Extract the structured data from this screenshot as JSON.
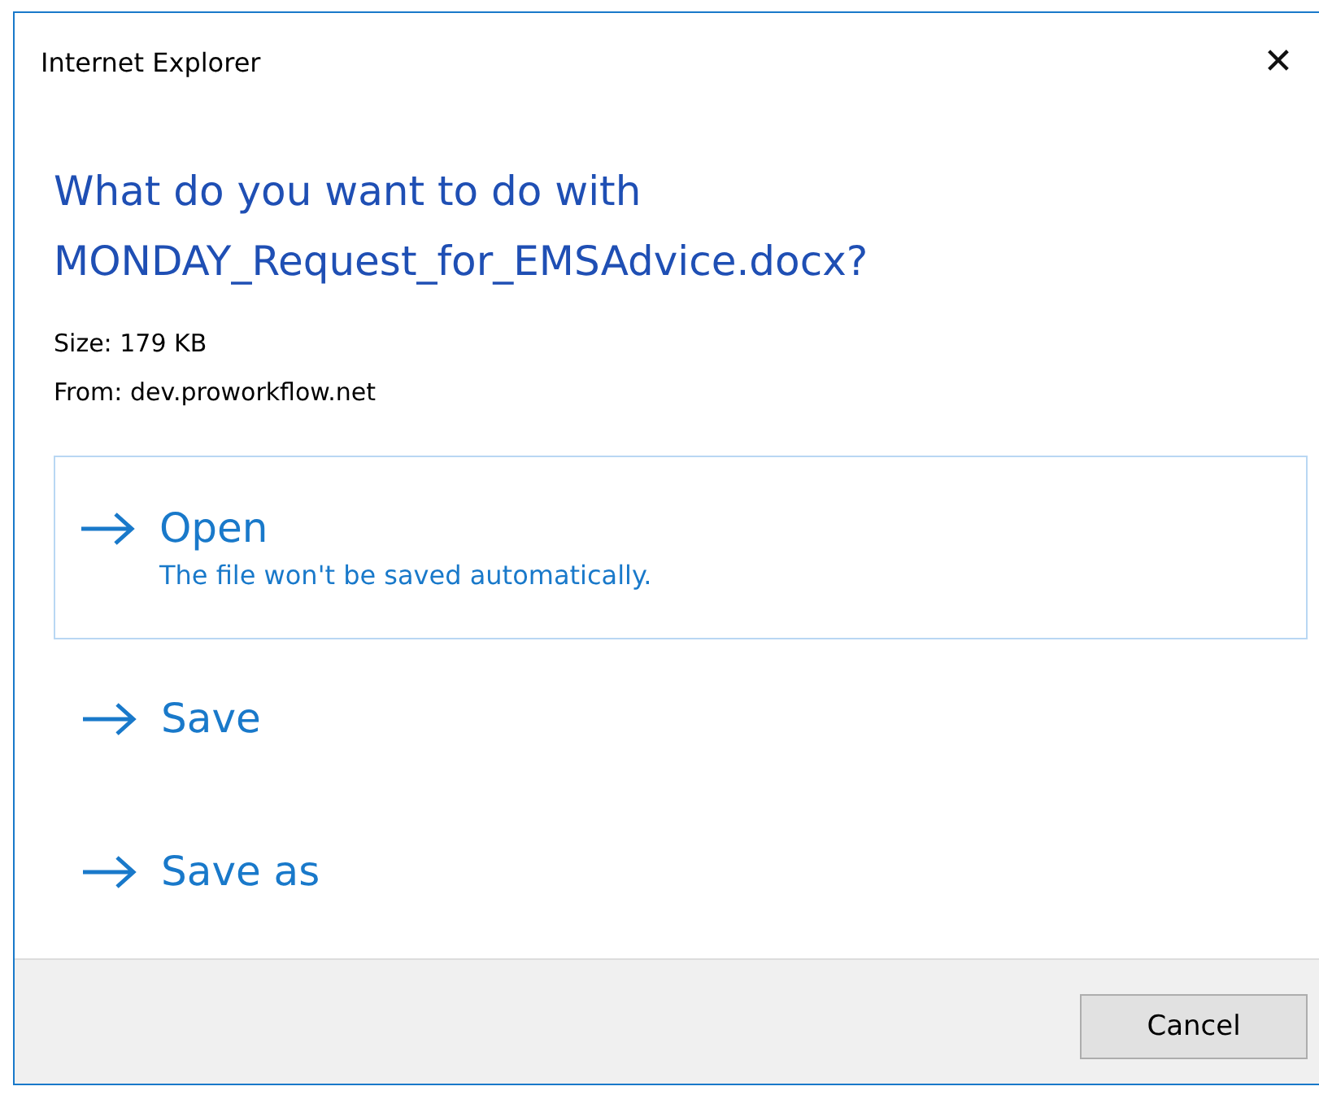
{
  "window": {
    "title": "Internet Explorer",
    "close": "✕"
  },
  "heading": "What do you want to do with MONDAY_Request_for_EMSAdvice.docx?",
  "details": [
    "Size: 179 KB",
    "From: dev.proworkflow.net"
  ],
  "options": [
    {
      "label": "Open",
      "note": "The file won't be saved automatically.",
      "selected": true
    },
    {
      "label": "Save",
      "selected": false
    },
    {
      "label": "Save as",
      "selected": false
    }
  ],
  "buttons": [
    "Cancel"
  ]
}
